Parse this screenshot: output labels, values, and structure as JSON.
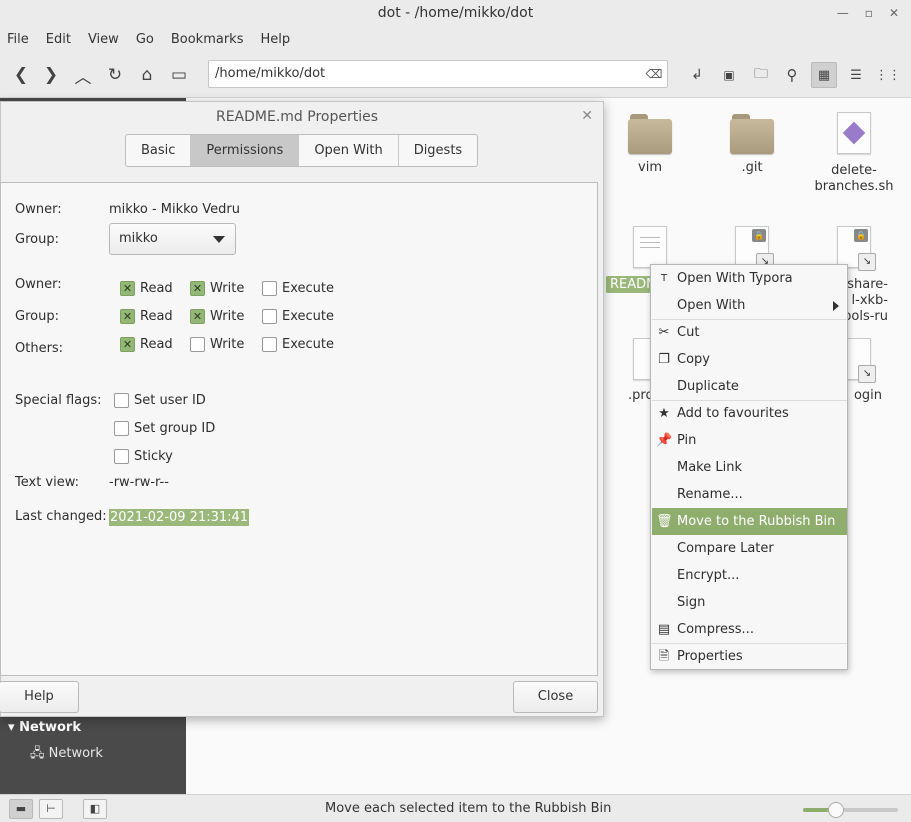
{
  "window": {
    "title": "dot - /home/mikko/dot"
  },
  "menubar": [
    "File",
    "Edit",
    "View",
    "Go",
    "Bookmarks",
    "Help"
  ],
  "toolbar": {
    "location": "/home/mikko/dot"
  },
  "sidebar": {
    "network_header": "Network",
    "network_item": "Network"
  },
  "files": [
    {
      "name": "vim"
    },
    {
      "name": ".git"
    },
    {
      "name": "delete-branches.sh"
    },
    {
      "name": "README.md"
    },
    {
      "name": "share-l-xkb-bols-ru"
    },
    {
      "name": ".pro"
    },
    {
      "name": "ogin"
    }
  ],
  "file_labels": {
    "f1": "vim",
    "f2": ".git",
    "f3a": "delete-",
    "f3b": "branches.sh",
    "f4": "READM",
    "f5a": "share-",
    "f5b": "l-xkb-",
    "f5c": "bols-ru",
    "f6": ".pro",
    "f7": "ogin"
  },
  "dialog": {
    "title": "README.md Properties",
    "tabs": [
      "Basic",
      "Permissions",
      "Open With",
      "Digests"
    ],
    "active_tab": "Permissions",
    "owner_label": "Owner:",
    "owner_value": "mikko - Mikko Vedru",
    "group_label": "Group:",
    "group_value": "mikko",
    "perm_owner_label": "Owner:",
    "perm_group_label": "Group:",
    "perm_others_label": "Others:",
    "read": "Read",
    "write": "Write",
    "execute": "Execute",
    "permissions": {
      "owner": {
        "read": true,
        "write": true,
        "execute": false
      },
      "group": {
        "read": true,
        "write": true,
        "execute": false
      },
      "others": {
        "read": true,
        "write": false,
        "execute": false
      }
    },
    "special_flags_label": "Special flags:",
    "set_user_id": "Set user ID",
    "set_group_id": "Set group ID",
    "sticky": "Sticky",
    "text_view_label": "Text view:",
    "text_view_value": "-rw-rw-r--",
    "last_changed_label": "Last changed:",
    "last_changed_value": "2021-02-09 21:31:41",
    "help_button": "Help",
    "close_button": "Close"
  },
  "context_menu": {
    "items": [
      {
        "label": "Open With Typora",
        "icon": "typora-icon"
      },
      {
        "label": "Open With",
        "icon": "",
        "submenu": true
      },
      {
        "label": "Cut",
        "icon": "scissors-icon"
      },
      {
        "label": "Copy",
        "icon": "copy-icon"
      },
      {
        "label": "Duplicate",
        "icon": ""
      },
      {
        "label": "Add to favourites",
        "icon": "star-icon"
      },
      {
        "label": "Pin",
        "icon": "pin-icon"
      },
      {
        "label": "Make Link",
        "icon": ""
      },
      {
        "label": "Rename...",
        "icon": ""
      },
      {
        "label": "Move to the Rubbish Bin",
        "icon": "trash-icon",
        "highlighted": true
      },
      {
        "label": "Compare Later",
        "icon": ""
      },
      {
        "label": "Encrypt...",
        "icon": ""
      },
      {
        "label": "Sign",
        "icon": ""
      },
      {
        "label": "Compress...",
        "icon": "archive-icon"
      },
      {
        "label": "Properties",
        "icon": "properties-icon"
      }
    ]
  },
  "statusbar": {
    "message": "Move each selected item to the Rubbish Bin",
    "zoom_level": 0.35
  },
  "colors": {
    "accent": "#8fae6e",
    "sidebar": "#4a4a4a"
  }
}
